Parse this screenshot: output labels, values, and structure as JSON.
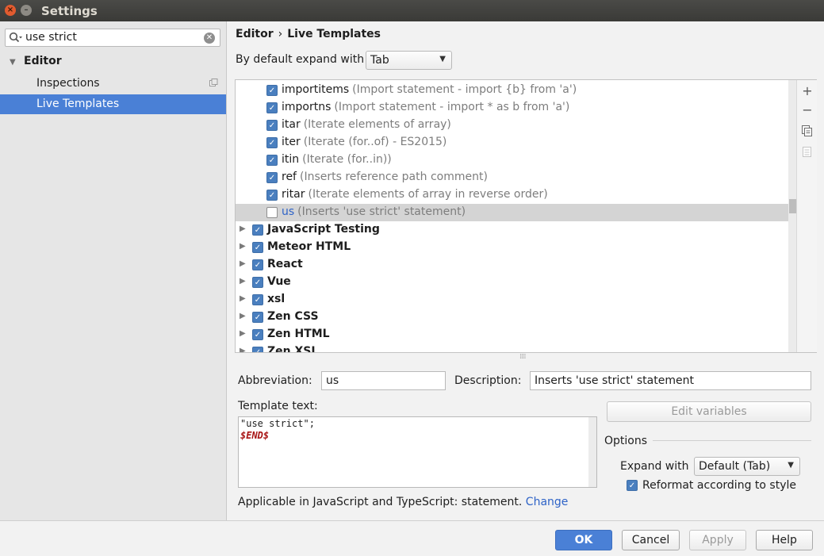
{
  "window": {
    "title": "Settings",
    "close_glyph": "×",
    "min_glyph": "–"
  },
  "sidebar": {
    "search_value": "use strict",
    "tree": {
      "editor_label": "Editor",
      "inspections_label": "Inspections",
      "live_templates_label": "Live Templates"
    }
  },
  "breadcrumb": {
    "parent": "Editor",
    "separator": "›",
    "current": "Live Templates"
  },
  "expand": {
    "label": "By default expand with",
    "value": "Tab"
  },
  "templates": {
    "rows": [
      {
        "name": "importitems",
        "desc": "(Import statement - import {b} from 'a')",
        "checked": true
      },
      {
        "name": "importns",
        "desc": "(Import statement - import * as b from 'a')",
        "checked": true
      },
      {
        "name": "itar",
        "desc": "(Iterate elements of array)",
        "checked": true
      },
      {
        "name": "iter",
        "desc": "(Iterate (for..of) - ES2015)",
        "checked": true
      },
      {
        "name": "itin",
        "desc": "(Iterate (for..in))",
        "checked": true
      },
      {
        "name": "ref",
        "desc": "(Inserts reference path comment)",
        "checked": true
      },
      {
        "name": "ritar",
        "desc": "(Iterate elements of array in reverse order)",
        "checked": true
      },
      {
        "name": "us",
        "desc": "(Inserts 'use strict' statement)",
        "checked": false,
        "selected": true
      }
    ],
    "groups": [
      {
        "name": "JavaScript Testing",
        "checked": true
      },
      {
        "name": "Meteor HTML",
        "checked": true
      },
      {
        "name": "React",
        "checked": true
      },
      {
        "name": "Vue",
        "checked": true
      },
      {
        "name": "xsl",
        "checked": true
      },
      {
        "name": "Zen CSS",
        "checked": true
      },
      {
        "name": "Zen HTML",
        "checked": true
      },
      {
        "name": "Zen XSL",
        "checked": true
      }
    ],
    "tools": {
      "add": "+",
      "remove": "−"
    },
    "scroll_position": 0.46
  },
  "details": {
    "abbreviation_label": "Abbreviation:",
    "abbreviation_value": "us",
    "description_label": "Description:",
    "description_value": "Inserts 'use strict' statement",
    "template_text_label": "Template text:",
    "template_lines": [
      "\"use strict\";",
      "$END$"
    ],
    "edit_variables_label": "Edit variables",
    "options_label": "Options",
    "expand_with_label": "Expand with",
    "expand_with_value": "Default (Tab)",
    "reformat_label": "Reformat according to style",
    "applicable_text": "Applicable in JavaScript and TypeScript: statement.",
    "change_link": "Change"
  },
  "footer": {
    "ok": "OK",
    "cancel": "Cancel",
    "apply": "Apply",
    "help": "Help"
  },
  "colors": {
    "accent": "#4a80d6",
    "selection_row": "#d4d4d4",
    "link": "#2e63c7",
    "variable": "#a81515"
  }
}
